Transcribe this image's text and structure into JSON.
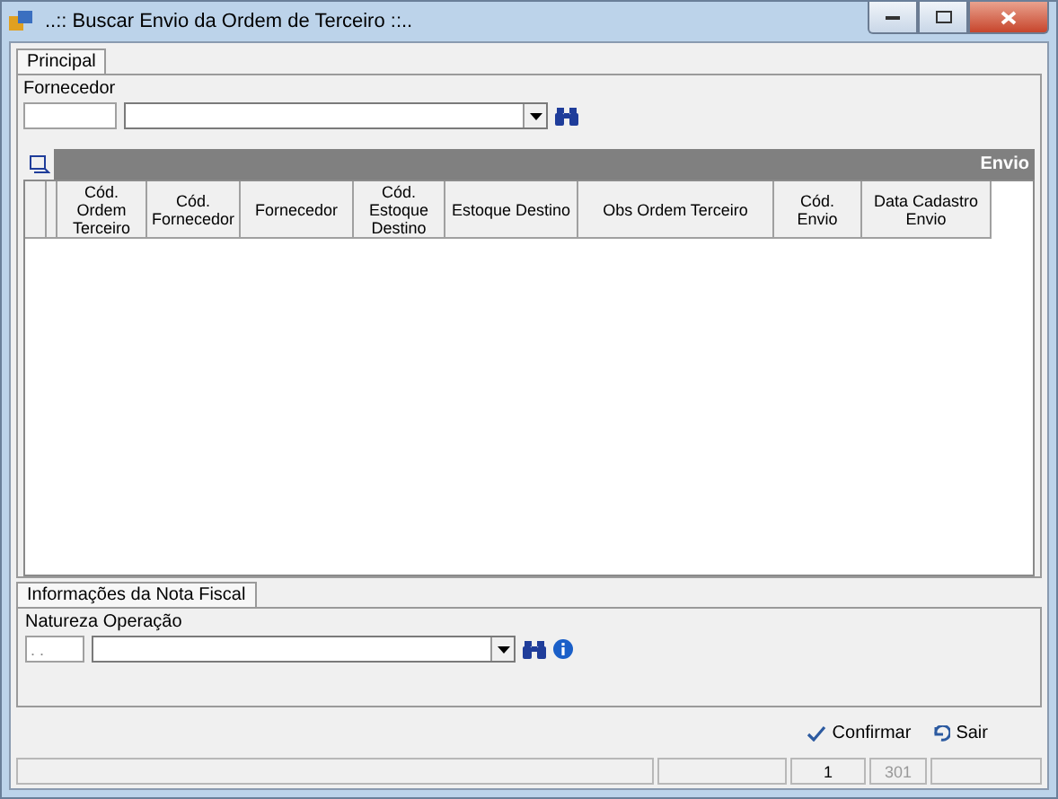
{
  "window": {
    "title": "..:: Buscar Envio da Ordem de Terceiro ::.."
  },
  "top_tabs": [
    {
      "label": "Principal",
      "selected": true
    }
  ],
  "fornecedor": {
    "label": "Fornecedor"
  },
  "grid": {
    "title": "Envio",
    "columns": [
      "Cód. Ordem Terceiro",
      "Cód. Fornecedor",
      "Fornecedor",
      "Cód. Estoque Destino",
      "Estoque Destino",
      "Obs Ordem Terceiro",
      "Cód. Envio",
      "Data Cadastro Envio"
    ]
  },
  "bottom_tabs": [
    {
      "label": "Informações da Nota Fiscal",
      "selected": true
    }
  ],
  "natureza": {
    "label": "Natureza Operação",
    "code_value": ". ."
  },
  "buttons": [
    {
      "label": "Confirmar",
      "kind": "confirm"
    },
    {
      "label": "Sair",
      "kind": "exit"
    }
  ],
  "status_bar": {
    "record": "1",
    "total": "301"
  }
}
